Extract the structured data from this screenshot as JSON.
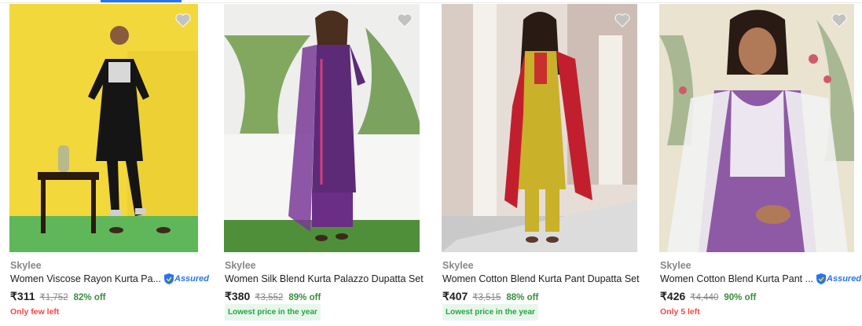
{
  "products": [
    {
      "brand": "Skylee",
      "title": "Women Viscose Rayon Kurta Pa...",
      "assured": "Assured",
      "price": "₹311",
      "mrp": "₹1,752",
      "discount": "82% off",
      "tag": "Only few left",
      "tag_type": "stock"
    },
    {
      "brand": "Skylee",
      "title": "Women Silk Blend Kurta Palazzo Dupatta Set",
      "price": "₹380",
      "mrp": "₹3,552",
      "discount": "89% off",
      "tag": "Lowest price in the year",
      "tag_type": "price"
    },
    {
      "brand": "Skylee",
      "title": "Women Cotton Blend Kurta Pant Dupatta Set",
      "price": "₹407",
      "mrp": "₹3,515",
      "discount": "88% off",
      "tag": "Lowest price in the year",
      "tag_type": "price"
    },
    {
      "brand": "Skylee",
      "title": "Women Cotton Blend Kurta Pant ...",
      "assured": "Assured",
      "price": "₹426",
      "mrp": "₹4,440",
      "discount": "90% off",
      "tag": "Only 5 left",
      "tag_type": "stock"
    }
  ],
  "colors": {
    "accent": "#2874f0",
    "discount": "#388e3c",
    "stock_tag": "#ff4343",
    "price_tag": "#26a541",
    "brand": "#878787"
  },
  "icons": {
    "wishlist": "heart-icon",
    "assured": "assured-shield-icon"
  }
}
